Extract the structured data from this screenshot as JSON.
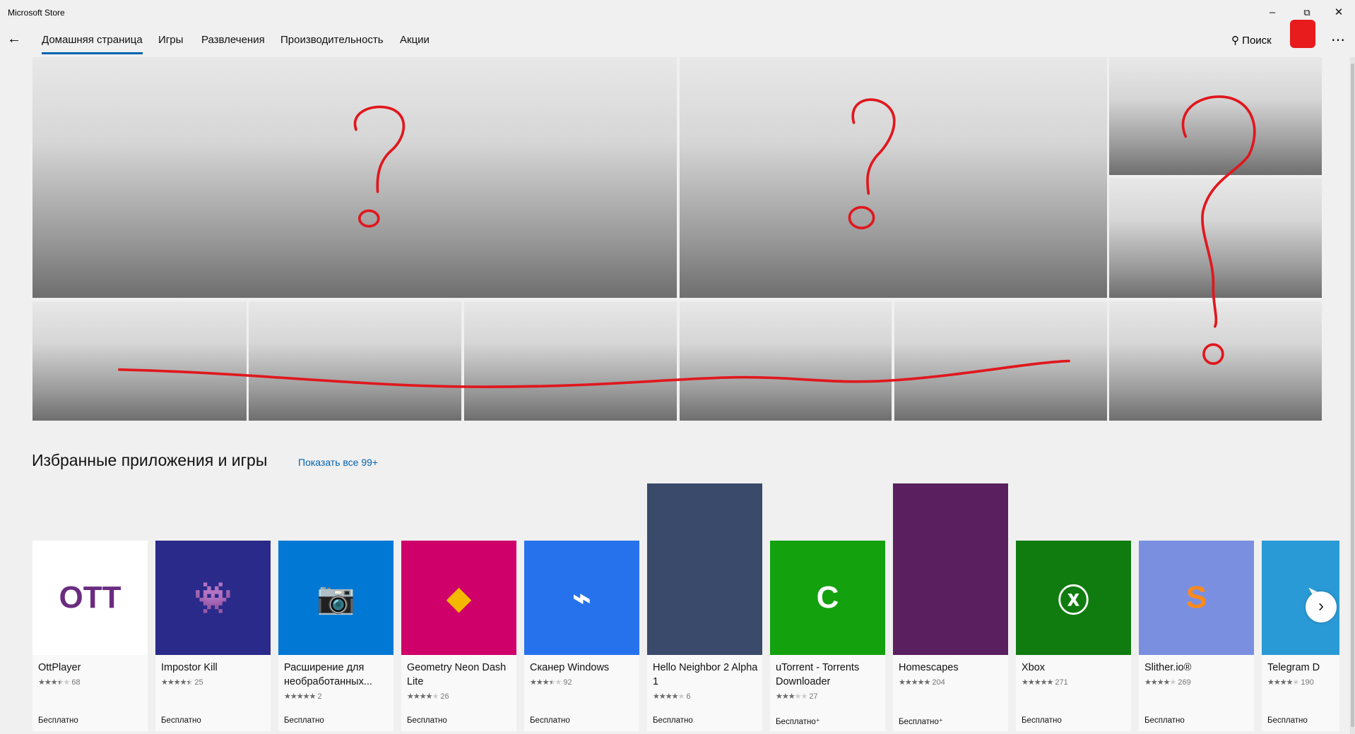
{
  "window": {
    "title": "Microsoft Store",
    "minimize_icon": "minimize-icon",
    "restore_icon": "restore-icon",
    "close_icon": "close-icon"
  },
  "nav": {
    "back_icon": "back-arrow-icon",
    "tabs": [
      {
        "label": "Домашняя страница",
        "active": true
      },
      {
        "label": "Игры"
      },
      {
        "label": "Развлечения"
      },
      {
        "label": "Производительность"
      },
      {
        "label": "Акции"
      }
    ],
    "search_label": "Поиск",
    "more_icon": "more-icon"
  },
  "accent_color": "#0063b1",
  "section": {
    "title": "Избранные приложения и игры",
    "show_all": "Показать все 99+"
  },
  "apps": [
    {
      "name": "OttPlayer",
      "rating": 3.5,
      "count": "68",
      "price": "Бесплатно",
      "color": "#ffffff"
    },
    {
      "name": "Impostor Kill",
      "rating": 4.5,
      "count": "25",
      "price": "Бесплатно",
      "color": "#2a2a8a"
    },
    {
      "name": "Расширение для необработанных...",
      "rating": 5,
      "count": "2",
      "price": "Бесплатно",
      "color": "#0078d4"
    },
    {
      "name": "Geometry Neon Dash Lite",
      "rating": 4,
      "count": "26",
      "price": "Бесплатно",
      "color": "#d0006a"
    },
    {
      "name": "Сканер Windows",
      "rating": 3.5,
      "count": "92",
      "price": "Бесплатно",
      "color": "#2672ec"
    },
    {
      "name": "Hello Neighbor 2 Alpha 1",
      "rating": 4,
      "count": "6",
      "price": "Бесплатно",
      "color": "#3a4a6a",
      "tall": true
    },
    {
      "name": "uTorrent - Torrents Downloader",
      "rating": 3,
      "count": "27",
      "price": "Бесплатно⁺",
      "color": "#13a10e"
    },
    {
      "name": "Homescapes",
      "rating": 5,
      "count": "204",
      "price": "Бесплатно⁺",
      "color": "#5a1f5f",
      "tall": true
    },
    {
      "name": "Xbox",
      "rating": 5,
      "count": "271",
      "price": "Бесплатно",
      "color": "#107c10"
    },
    {
      "name": "Slither.io®",
      "rating": 4,
      "count": "269",
      "price": "Бесплатно",
      "color": "#7b8fe0"
    },
    {
      "name": "Telegram D",
      "rating": 4,
      "count": "190",
      "price": "Бесплатно",
      "color": "#2a9ad6"
    }
  ]
}
